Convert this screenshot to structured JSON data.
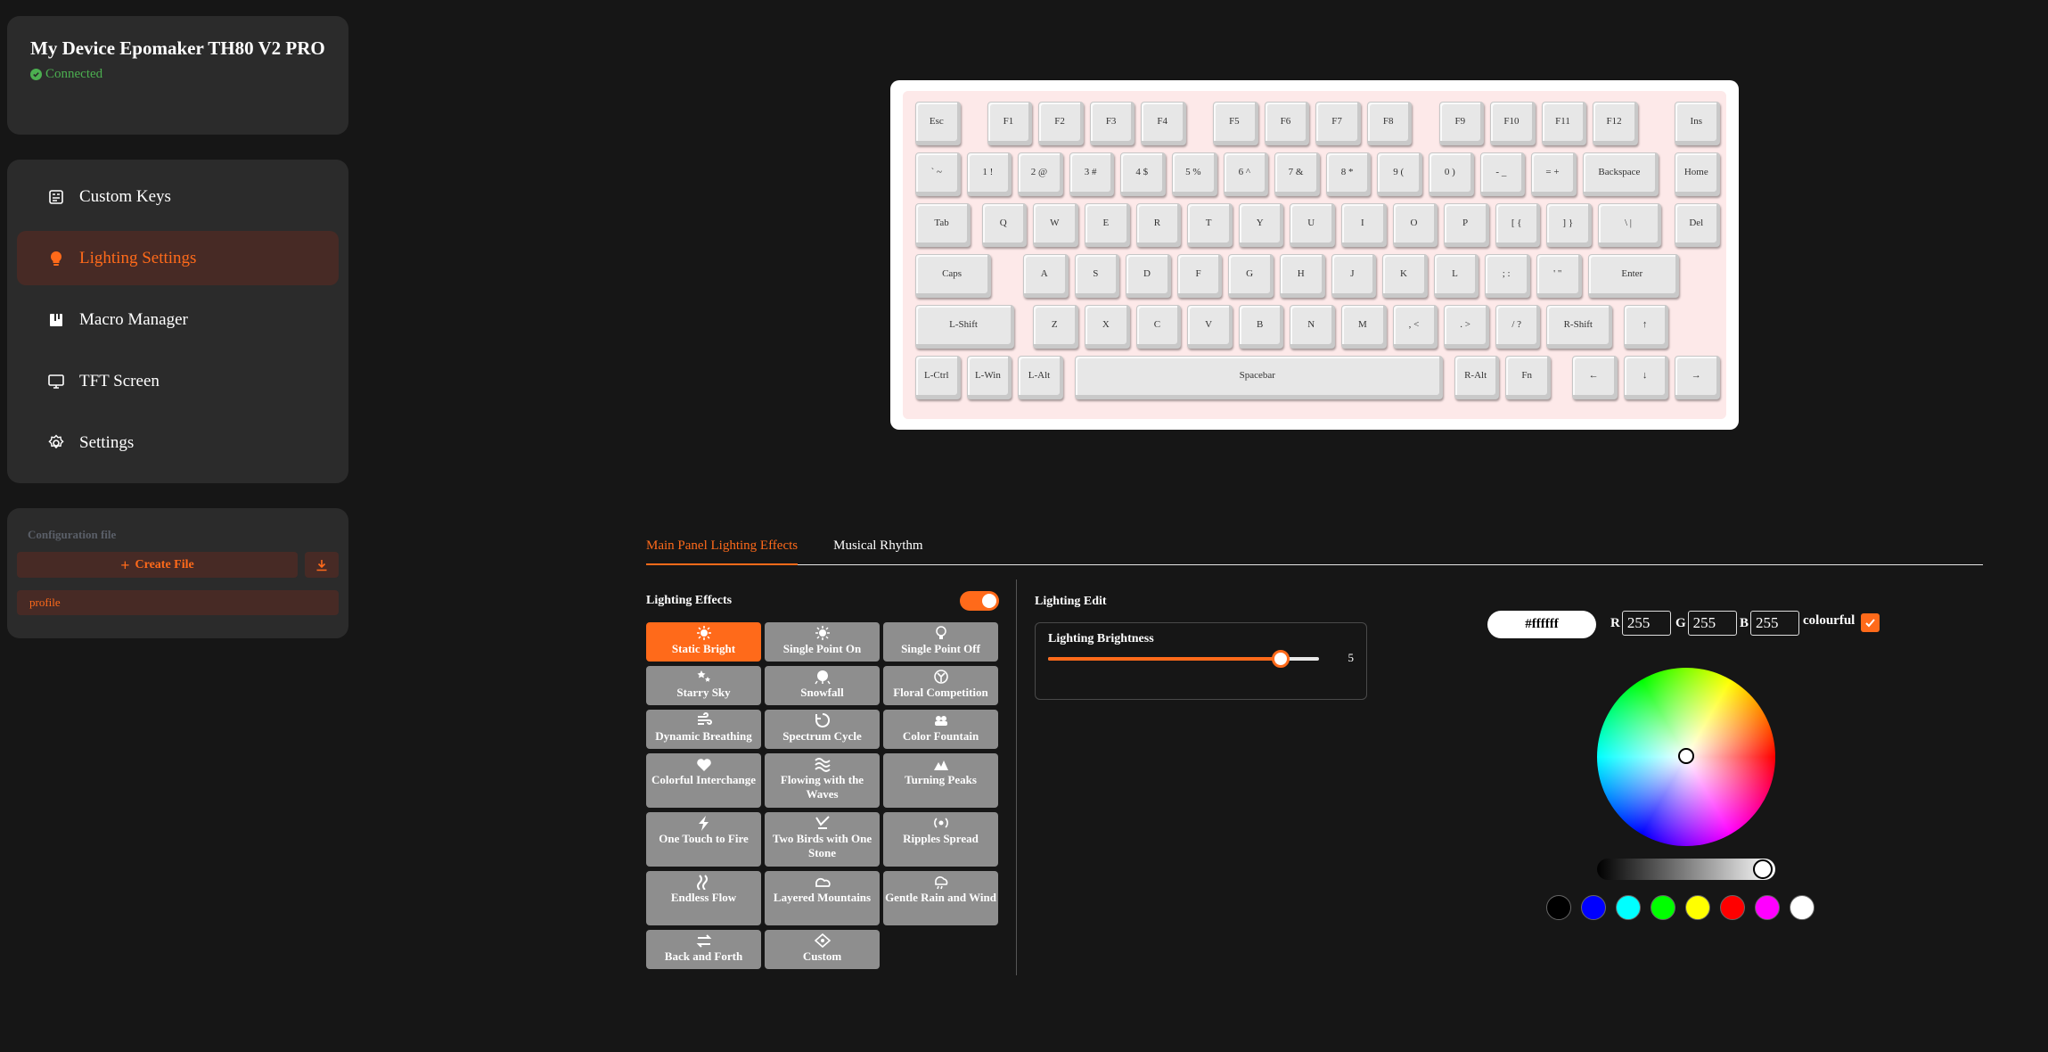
{
  "device": {
    "name": "My Device Epomaker TH80 V2 PRO",
    "status": "Connected"
  },
  "nav": [
    {
      "label": "Custom Keys",
      "icon": "custom-keys-icon"
    },
    {
      "label": "Lighting Settings",
      "icon": "lightbulb-icon",
      "active": true
    },
    {
      "label": "Macro Manager",
      "icon": "macro-icon"
    },
    {
      "label": "TFT Screen",
      "icon": "monitor-icon"
    },
    {
      "label": "Settings",
      "icon": "gear-icon"
    }
  ],
  "config": {
    "label": "Configuration file",
    "create": "Create File",
    "profile": "profile"
  },
  "keyboard": {
    "rows": [
      [
        "Esc",
        "F1",
        "F2",
        "F3",
        "F4",
        "F5",
        "F6",
        "F7",
        "F8",
        "F9",
        "F10",
        "F11",
        "F12",
        "Ins"
      ],
      [
        "` ~",
        "1 !",
        "2 @",
        "3 #",
        "4 $",
        "5 %",
        "6 ^",
        "7 &",
        "8 *",
        "9 (",
        "0 )",
        "- _",
        "= +",
        "Backspace",
        "Home"
      ],
      [
        "Tab",
        "Q",
        "W",
        "E",
        "R",
        "T",
        "Y",
        "U",
        "I",
        "O",
        "P",
        "[ {",
        "] }",
        "\\ |",
        "Del"
      ],
      [
        "Caps",
        "A",
        "S",
        "D",
        "F",
        "G",
        "H",
        "J",
        "K",
        "L",
        "; :",
        "' \"",
        "Enter"
      ],
      [
        "L-Shift",
        "Z",
        "X",
        "C",
        "V",
        "B",
        "N",
        "M",
        ", <",
        ". >",
        "/ ?",
        "R-Shift",
        "↑"
      ],
      [
        "L-Ctrl",
        "L-Win",
        "L-Alt",
        "Spacebar",
        "R-Alt",
        "Fn",
        "←",
        "↓",
        "→"
      ]
    ]
  },
  "tabs": [
    {
      "label": "Main Panel Lighting Effects",
      "active": true
    },
    {
      "label": "Musical Rhythm"
    }
  ],
  "effects": {
    "title": "Lighting Effects",
    "enabled": true,
    "items": [
      {
        "label": "Static Bright",
        "icon": "sun-icon",
        "active": true
      },
      {
        "label": "Single Point On",
        "icon": "sun-icon"
      },
      {
        "label": "Single Point Off",
        "icon": "bulb-icon"
      },
      {
        "label": "Starry Sky",
        "icon": "stars-icon"
      },
      {
        "label": "Snowfall",
        "icon": "snowflake-icon"
      },
      {
        "label": "Floral Competition",
        "icon": "flower-icon"
      },
      {
        "label": "Dynamic Breathing",
        "icon": "wind-icon"
      },
      {
        "label": "Spectrum Cycle",
        "icon": "cycle-icon"
      },
      {
        "label": "Color Fountain",
        "icon": "fountain-icon"
      },
      {
        "label": "Colorful Interchange",
        "icon": "heart-icon"
      },
      {
        "label": "Flowing with the Waves",
        "icon": "waves-icon"
      },
      {
        "label": "Turning Peaks",
        "icon": "peaks-icon"
      },
      {
        "label": "One Touch to Fire",
        "icon": "bolt-icon"
      },
      {
        "label": "Two Birds with One Stone",
        "icon": "birds-icon"
      },
      {
        "label": "Ripples Spread",
        "icon": "ripple-icon"
      },
      {
        "label": "Endless Flow",
        "icon": "flow-icon"
      },
      {
        "label": "Layered Mountains",
        "icon": "mountain-icon"
      },
      {
        "label": "Gentle Rain and Wind",
        "icon": "rain-icon"
      },
      {
        "label": "Back and Forth",
        "icon": "arrows-icon"
      },
      {
        "label": "Custom",
        "icon": "custom-icon"
      }
    ]
  },
  "edit": {
    "title": "Lighting Edit",
    "brightness_label": "Lighting Brightness",
    "brightness": 5,
    "brightness_fraction": 0.86
  },
  "color": {
    "hex": "#ffffff",
    "r": "255",
    "g": "255",
    "b": "255",
    "r_label": "R",
    "g_label": "G",
    "b_label": "B",
    "colourful_label": "colourful",
    "colourful": true,
    "swatches": [
      "#000000",
      "#0000ff",
      "#00ffff",
      "#00ff00",
      "#ffff00",
      "#ff0000",
      "#ff00ff",
      "#ffffff"
    ]
  },
  "accent": "#ff6a1a"
}
